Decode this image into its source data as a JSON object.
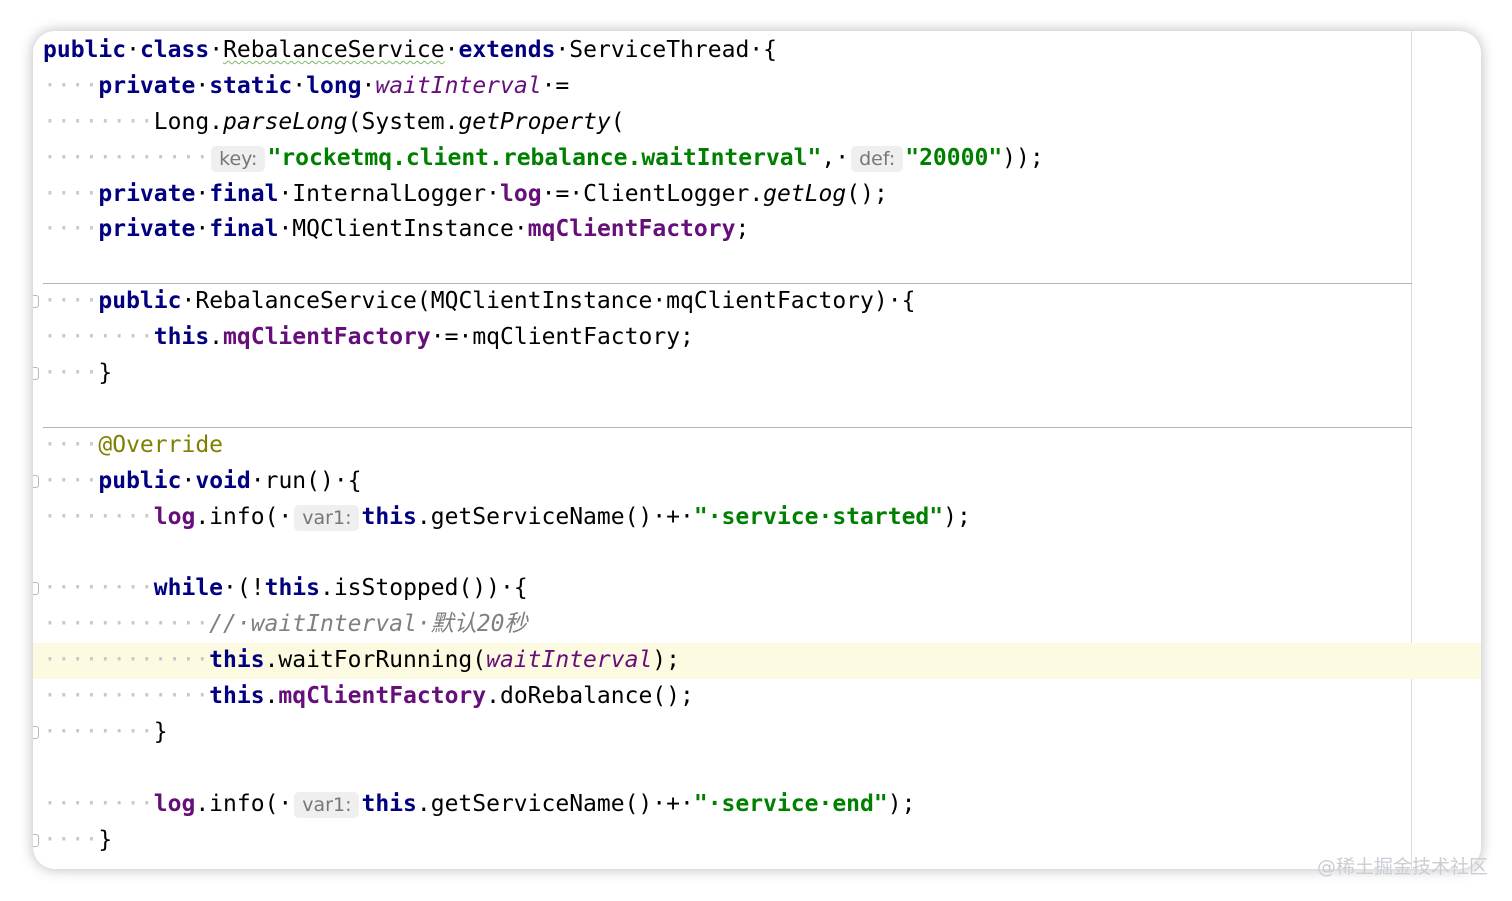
{
  "editor": {
    "lines": [
      {
        "segments": [
          {
            "t": "public",
            "c": "kw"
          },
          {
            "t": "·"
          },
          {
            "t": "class",
            "c": "kw"
          },
          {
            "t": "·"
          },
          {
            "t": "RebalanceService",
            "c": "squig"
          },
          {
            "t": "·"
          },
          {
            "t": "extends",
            "c": "kw"
          },
          {
            "t": "·"
          },
          {
            "t": "ServiceThread"
          },
          {
            "t": "·"
          },
          {
            "t": "{"
          }
        ]
      },
      {
        "segments": [
          {
            "t": "····",
            "c": "indent"
          },
          {
            "t": "private",
            "c": "kw"
          },
          {
            "t": "·"
          },
          {
            "t": "static",
            "c": "kw"
          },
          {
            "t": "·"
          },
          {
            "t": "long",
            "c": "kw"
          },
          {
            "t": "·"
          },
          {
            "t": "waitInterval",
            "c": "static-field"
          },
          {
            "t": "·"
          },
          {
            "t": "="
          }
        ]
      },
      {
        "segments": [
          {
            "t": "········",
            "c": "indent"
          },
          {
            "t": "Long."
          },
          {
            "t": "parseLong",
            "c": "italic"
          },
          {
            "t": "(System."
          },
          {
            "t": "getProperty",
            "c": "italic"
          },
          {
            "t": "("
          }
        ]
      },
      {
        "segments": [
          {
            "t": "············",
            "c": "indent"
          },
          {
            "t": "key:",
            "c": "hint"
          },
          {
            "t": "\"rocketmq.client.rebalance.waitInterval\"",
            "c": "str"
          },
          {
            "t": ","
          },
          {
            "t": "·"
          },
          {
            "t": "def:",
            "c": "hint"
          },
          {
            "t": "\"20000\"",
            "c": "str"
          },
          {
            "t": "));"
          }
        ]
      },
      {
        "segments": [
          {
            "t": "····",
            "c": "indent"
          },
          {
            "t": "private",
            "c": "kw"
          },
          {
            "t": "·"
          },
          {
            "t": "final",
            "c": "kw"
          },
          {
            "t": "·"
          },
          {
            "t": "InternalLogger"
          },
          {
            "t": "·"
          },
          {
            "t": "log",
            "c": "field"
          },
          {
            "t": "·"
          },
          {
            "t": "="
          },
          {
            "t": "·"
          },
          {
            "t": "ClientLogger."
          },
          {
            "t": "getLog",
            "c": "italic"
          },
          {
            "t": "();"
          }
        ]
      },
      {
        "segments": [
          {
            "t": "····",
            "c": "indent"
          },
          {
            "t": "private",
            "c": "kw"
          },
          {
            "t": "·"
          },
          {
            "t": "final",
            "c": "kw"
          },
          {
            "t": "·"
          },
          {
            "t": "MQClientInstance"
          },
          {
            "t": "·"
          },
          {
            "t": "mqClientFactory",
            "c": "field"
          },
          {
            "t": ";"
          }
        ]
      },
      {
        "segments": [],
        "separator": true
      },
      {
        "segments": [
          {
            "t": "····",
            "c": "indent"
          },
          {
            "t": "public",
            "c": "kw"
          },
          {
            "t": "·"
          },
          {
            "t": "RebalanceService(MQClientInstance"
          },
          {
            "t": "·"
          },
          {
            "t": "mqClientFactory)"
          },
          {
            "t": "·"
          },
          {
            "t": "{"
          }
        ],
        "fold": true
      },
      {
        "segments": [
          {
            "t": "········",
            "c": "indent"
          },
          {
            "t": "this",
            "c": "kw"
          },
          {
            "t": "."
          },
          {
            "t": "mqClientFactory",
            "c": "field"
          },
          {
            "t": "·"
          },
          {
            "t": "="
          },
          {
            "t": "·"
          },
          {
            "t": "mqClientFactory;"
          }
        ]
      },
      {
        "segments": [
          {
            "t": "····",
            "c": "indent"
          },
          {
            "t": "}"
          }
        ],
        "fold": true
      },
      {
        "segments": [],
        "separator": true
      },
      {
        "segments": [
          {
            "t": "····",
            "c": "indent"
          },
          {
            "t": "@Override",
            "c": "ann"
          }
        ]
      },
      {
        "segments": [
          {
            "t": "····",
            "c": "indent"
          },
          {
            "t": "public",
            "c": "kw"
          },
          {
            "t": "·"
          },
          {
            "t": "void",
            "c": "kw"
          },
          {
            "t": "·"
          },
          {
            "t": "run()"
          },
          {
            "t": "·"
          },
          {
            "t": "{"
          }
        ],
        "fold": true
      },
      {
        "segments": [
          {
            "t": "········",
            "c": "indent"
          },
          {
            "t": "log",
            "c": "field"
          },
          {
            "t": ".info("
          },
          {
            "t": "·"
          },
          {
            "t": "var1:",
            "c": "hint"
          },
          {
            "t": "this",
            "c": "kw"
          },
          {
            "t": ".getServiceName()"
          },
          {
            "t": "·"
          },
          {
            "t": "+"
          },
          {
            "t": "·"
          },
          {
            "t": "\"·service·started\"",
            "c": "str"
          },
          {
            "t": ");"
          }
        ]
      },
      {
        "segments": []
      },
      {
        "segments": [
          {
            "t": "········",
            "c": "indent"
          },
          {
            "t": "while",
            "c": "kw"
          },
          {
            "t": "·"
          },
          {
            "t": "(!"
          },
          {
            "t": "this",
            "c": "kw"
          },
          {
            "t": ".isStopped())"
          },
          {
            "t": "·"
          },
          {
            "t": "{"
          }
        ],
        "fold": true
      },
      {
        "segments": [
          {
            "t": "············",
            "c": "indent"
          },
          {
            "t": "//·waitInterval·默认20秒",
            "c": "comment"
          }
        ]
      },
      {
        "segments": [
          {
            "t": "············",
            "c": "indent"
          },
          {
            "t": "this",
            "c": "kw"
          },
          {
            "t": ".waitForRunning("
          },
          {
            "t": "waitInterval",
            "c": "static-field"
          },
          {
            "t": ");"
          }
        ],
        "highlight": true
      },
      {
        "segments": [
          {
            "t": "············",
            "c": "indent"
          },
          {
            "t": "this",
            "c": "kw"
          },
          {
            "t": "."
          },
          {
            "t": "mqClientFactory",
            "c": "field"
          },
          {
            "t": ".doRebalance();"
          }
        ]
      },
      {
        "segments": [
          {
            "t": "········",
            "c": "indent"
          },
          {
            "t": "}"
          }
        ],
        "fold": true
      },
      {
        "segments": []
      },
      {
        "segments": [
          {
            "t": "········",
            "c": "indent"
          },
          {
            "t": "log",
            "c": "field"
          },
          {
            "t": ".info("
          },
          {
            "t": "·"
          },
          {
            "t": "var1:",
            "c": "hint"
          },
          {
            "t": "this",
            "c": "kw"
          },
          {
            "t": ".getServiceName()"
          },
          {
            "t": "·"
          },
          {
            "t": "+"
          },
          {
            "t": "·"
          },
          {
            "t": "\"·service·end\"",
            "c": "str"
          },
          {
            "t": ");"
          }
        ]
      },
      {
        "segments": [
          {
            "t": "····",
            "c": "indent"
          },
          {
            "t": "}"
          }
        ],
        "fold": true
      }
    ]
  },
  "watermark": "@稀土掘金技术社区"
}
